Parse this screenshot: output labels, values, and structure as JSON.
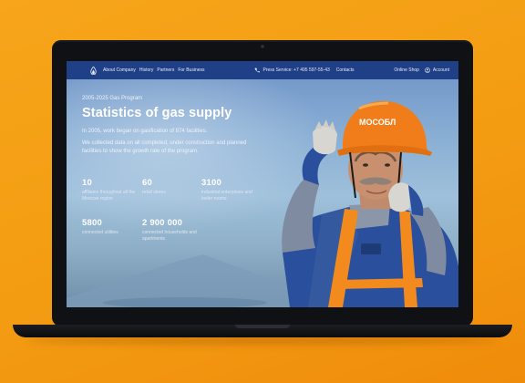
{
  "nav": {
    "links": [
      "About Company",
      "History",
      "Partners",
      "For Business"
    ],
    "press": "Press Service: +7 495 597-55-43",
    "contacts": "Contacts",
    "shop": "Online Shop",
    "account": "Account"
  },
  "hero": {
    "eyebrow": "2005-2025 Gas Program",
    "title": "Statistics of gas supply",
    "para1": "In 2005, work began on gasification of 874 facilities.",
    "para2": "We collected data on all completed, under construction and planned facilities to show the growth rate of the program."
  },
  "stats": [
    {
      "value": "10",
      "label": "affiliates throughout all the Moscow region"
    },
    {
      "value": "60",
      "label": "retail stores"
    },
    {
      "value": "3100",
      "label": "industrial enterprises and boiler rooms"
    },
    {
      "value": "5800",
      "label": "connected utilities"
    },
    {
      "value": "2 900 000",
      "label": "connected households and apartments"
    }
  ],
  "helmet_text": "МОСОБЛ",
  "colors": {
    "background": "#f39c12",
    "navbar": "#1f3f86",
    "helmet": "#f07d1a",
    "uniform": "#2a4f9c"
  },
  "icons": [
    "logo-flame-icon",
    "phone-icon",
    "account-icon"
  ]
}
